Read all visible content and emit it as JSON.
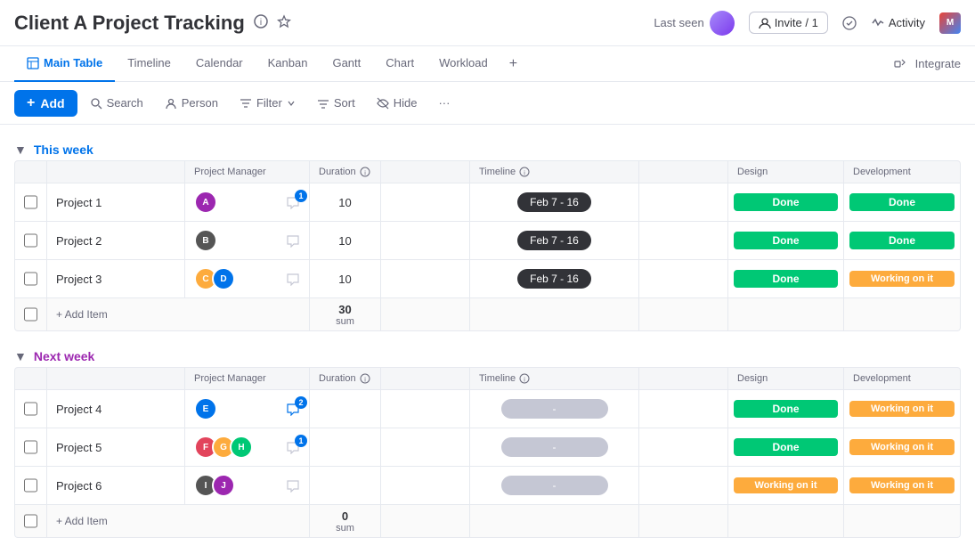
{
  "app": {
    "title": "Client A Project Tracking",
    "last_seen_label": "Last seen",
    "invite_label": "Invite / 1",
    "activity_label": "Activity"
  },
  "tabs": [
    {
      "id": "main-table",
      "label": "Main Table",
      "active": true
    },
    {
      "id": "timeline",
      "label": "Timeline",
      "active": false
    },
    {
      "id": "calendar",
      "label": "Calendar",
      "active": false
    },
    {
      "id": "kanban",
      "label": "Kanban",
      "active": false
    },
    {
      "id": "gantt",
      "label": "Gantt",
      "active": false
    },
    {
      "id": "chart",
      "label": "Chart",
      "active": false
    },
    {
      "id": "workload",
      "label": "Workload",
      "active": false
    }
  ],
  "integrate_label": "Integrate",
  "toolbar": {
    "add_label": "Add",
    "search_label": "Search",
    "person_label": "Person",
    "filter_label": "Filter",
    "sort_label": "Sort",
    "hide_label": "Hide",
    "more_label": "···"
  },
  "this_week": {
    "title": "This week",
    "columns": [
      "",
      "",
      "Project Manager",
      "Duration",
      "",
      "Timeline",
      "",
      "Design",
      "Development"
    ],
    "rows": [
      {
        "name": "Project 1",
        "duration": "10",
        "timeline": "Feb 7 - 16",
        "design": "Done",
        "development": "Done"
      },
      {
        "name": "Project 2",
        "duration": "10",
        "timeline": "Feb 7 - 16",
        "design": "Done",
        "development": "Done"
      },
      {
        "name": "Project 3",
        "duration": "10",
        "timeline": "Feb 7 - 16",
        "design": "Done",
        "development": "Working on it"
      }
    ],
    "sum_label": "sum",
    "sum_value": "30",
    "add_item_label": "+ Add Item"
  },
  "next_week": {
    "title": "Next week",
    "columns": [
      "",
      "",
      "Project Manager",
      "Duration",
      "",
      "Timeline",
      "",
      "Design",
      "Development"
    ],
    "rows": [
      {
        "name": "Project 4",
        "duration": "",
        "timeline": "-",
        "design": "Done",
        "development": "Working on it"
      },
      {
        "name": "Project 5",
        "duration": "",
        "timeline": "-",
        "design": "Done",
        "development": "Working on it"
      },
      {
        "name": "Project 6",
        "duration": "",
        "timeline": "-",
        "design": "Working on it",
        "development": "Working on it"
      }
    ],
    "sum_label": "sum",
    "sum_value": "0",
    "add_item_label": "+ Add Item"
  },
  "colors": {
    "done": "#00c875",
    "working_on_it": "#fdab3d",
    "timeline_dark": "#323338",
    "timeline_empty": "#c5c7d4",
    "blue": "#0073ea",
    "purple": "#9c27b0"
  }
}
